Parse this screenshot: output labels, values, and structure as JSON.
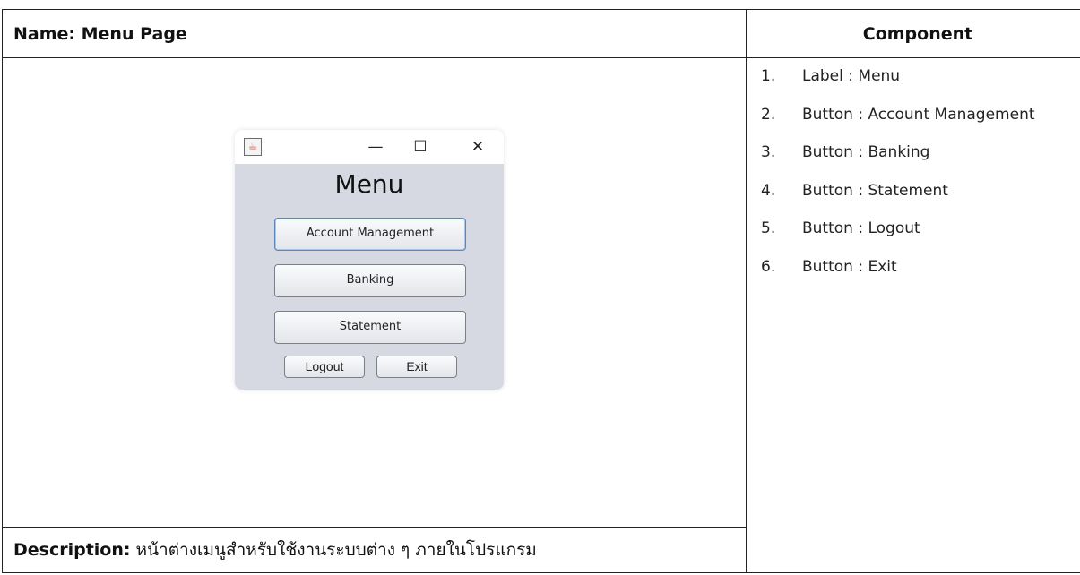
{
  "header": {
    "name_label": "Name: Menu Page",
    "component_label": "Component"
  },
  "window": {
    "title_text": "Menu",
    "controls": {
      "minimize": "—",
      "maximize": "☐",
      "close": "✕"
    },
    "buttons": {
      "account_management": "Account Management",
      "banking": "Banking",
      "statement": "Statement",
      "logout": "Logout",
      "exit": "Exit"
    }
  },
  "components": [
    {
      "num": "1.",
      "text": "Label : Menu"
    },
    {
      "num": "2.",
      "text": "Button : Account Management"
    },
    {
      "num": "3.",
      "text": "Button : Banking"
    },
    {
      "num": "4.",
      "text": "Button : Statement"
    },
    {
      "num": "5.",
      "text": "Button : Logout"
    },
    {
      "num": "6.",
      "text": "Button : Exit"
    }
  ],
  "description": {
    "label": "Description:",
    "text": " หน้าต่างเมนูสำหรับใช้งานระบบต่าง ๆ ภายในโปรแกรม"
  },
  "icons": {
    "app_icon": "java-app-icon"
  }
}
